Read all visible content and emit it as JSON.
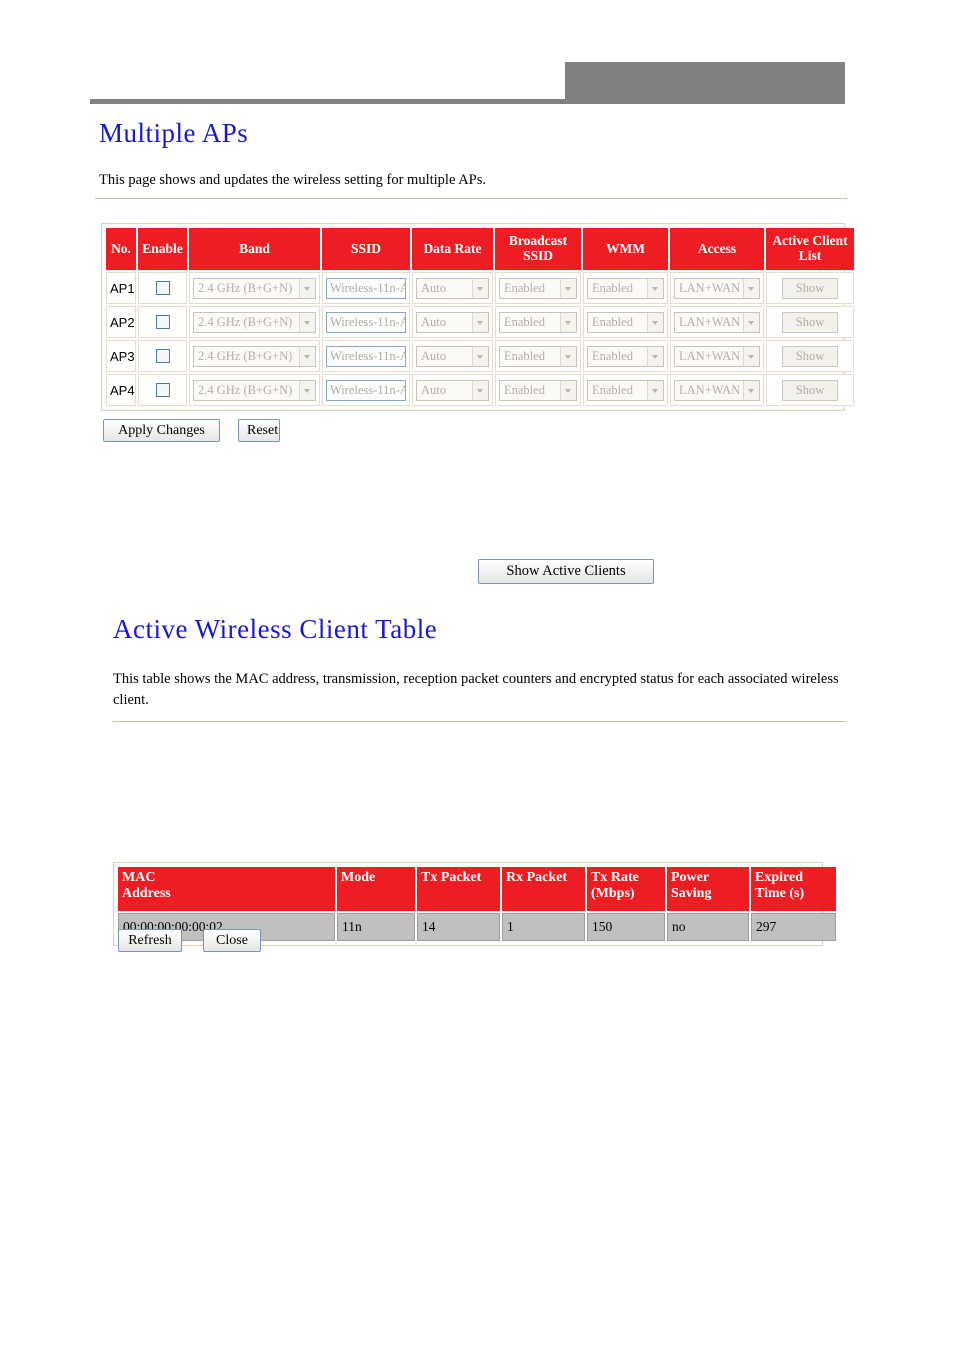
{
  "banner": {
    "accent_gray": "#808080"
  },
  "theme": {
    "header_red": "#ee1d24",
    "title_blue": "#1818cf",
    "row_gray": "#c0c0c0"
  },
  "multiple_aps": {
    "title": "Multiple APs",
    "description": "This page shows and updates the wireless setting for multiple APs.",
    "columns": [
      "No.",
      "Enable",
      "Band",
      "SSID",
      "Data Rate",
      "Broadcast SSID",
      "WMM",
      "Access",
      "Active Client List"
    ],
    "rows": [
      {
        "no": "AP1",
        "enabled": false,
        "band": "2.4 GHz (B+G+N)",
        "ssid": "Wireless-11n-A",
        "data_rate": "Auto",
        "broadcast_ssid": "Enabled",
        "wmm": "Enabled",
        "access": "LAN+WAN",
        "show_label": "Show"
      },
      {
        "no": "AP2",
        "enabled": false,
        "band": "2.4 GHz (B+G+N)",
        "ssid": "Wireless-11n-A",
        "data_rate": "Auto",
        "broadcast_ssid": "Enabled",
        "wmm": "Enabled",
        "access": "LAN+WAN",
        "show_label": "Show"
      },
      {
        "no": "AP3",
        "enabled": false,
        "band": "2.4 GHz (B+G+N)",
        "ssid": "Wireless-11n-A",
        "data_rate": "Auto",
        "broadcast_ssid": "Enabled",
        "wmm": "Enabled",
        "access": "LAN+WAN",
        "show_label": "Show"
      },
      {
        "no": "AP4",
        "enabled": false,
        "band": "2.4 GHz (B+G+N)",
        "ssid": "Wireless-11n-A",
        "data_rate": "Auto",
        "broadcast_ssid": "Enabled",
        "wmm": "Enabled",
        "access": "LAN+WAN",
        "show_label": "Show"
      }
    ],
    "apply_label": "Apply Changes",
    "reset_label": "Reset"
  },
  "show_active_clients_label": "Show Active Clients",
  "client_table": {
    "title": "Active Wireless Client Table",
    "description": "This table shows the MAC address, transmission, reception packet counters and encrypted status for each associated wireless client.",
    "columns": [
      "MAC Address",
      "Mode",
      "Tx Packet",
      "Rx Packet",
      "Tx Rate (Mbps)",
      "Power Saving",
      "Expired Time (s)"
    ],
    "columns_split": [
      {
        "line1": "MAC",
        "line2": "Address"
      },
      {
        "line1": "Mode",
        "line2": ""
      },
      {
        "line1": "Tx Packet",
        "line2": ""
      },
      {
        "line1": "Rx Packet",
        "line2": ""
      },
      {
        "line1": "Tx Rate",
        "line2": "(Mbps)"
      },
      {
        "line1": "Power",
        "line2": "Saving"
      },
      {
        "line1": "Expired",
        "line2": "Time (s)"
      }
    ],
    "rows": [
      {
        "mac_address": "00:00:00:00:00:02",
        "mode": "11n",
        "tx_packet": "14",
        "rx_packet": "1",
        "tx_rate": "150",
        "power_saving": "no",
        "expired_time": "297"
      }
    ],
    "refresh_label": "Refresh",
    "close_label": "Close"
  }
}
